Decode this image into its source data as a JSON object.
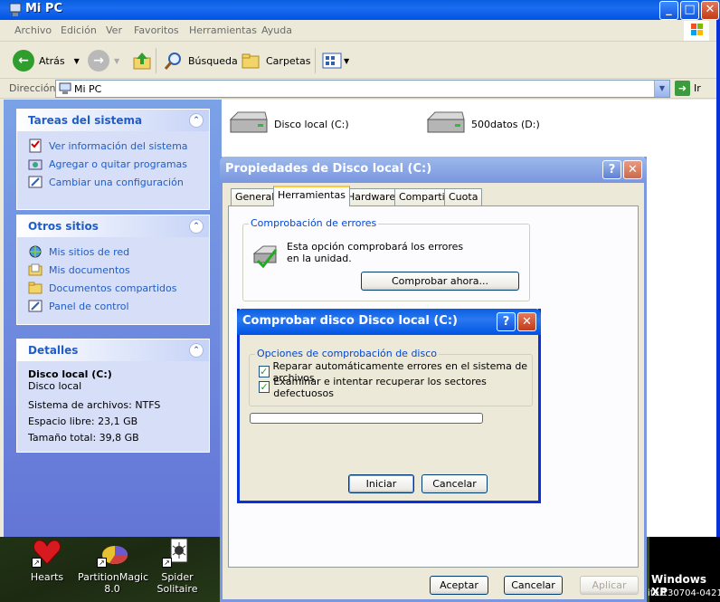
{
  "explorer": {
    "title": "Mi PC",
    "menu": [
      "Archivo",
      "Edición",
      "Ver",
      "Favoritos",
      "Herramientas",
      "Ayuda"
    ],
    "toolbar": {
      "back": "Atrás",
      "search": "Búsqueda",
      "folders": "Carpetas"
    },
    "address": {
      "label": "Dirección",
      "value": "Mi PC",
      "go": "Ir"
    },
    "system_tasks": {
      "title": "Tareas del sistema",
      "items": [
        {
          "label": "Ver información del sistema",
          "icon": "system-info-icon"
        },
        {
          "label": "Agregar o quitar programas",
          "icon": "add-remove-icon"
        },
        {
          "label": "Cambiar una configuración",
          "icon": "control-panel-icon"
        }
      ]
    },
    "other_places": {
      "title": "Otros sitios",
      "items": [
        {
          "label": "Mis sitios de red",
          "icon": "network-icon"
        },
        {
          "label": "Mis documentos",
          "icon": "documents-icon"
        },
        {
          "label": "Documentos compartidos",
          "icon": "shared-folder-icon"
        },
        {
          "label": "Panel de control",
          "icon": "control-panel-icon"
        }
      ]
    },
    "details": {
      "title": "Detalles",
      "name": "Disco local (C:)",
      "type": "Disco local",
      "filesystem": "Sistema de archivos: NTFS",
      "free": "Espacio libre: 23,1 GB",
      "total": "Tamaño total: 39,8 GB"
    },
    "drives": [
      {
        "label": "Disco local (C:)"
      },
      {
        "label": "500datos (D:)"
      }
    ]
  },
  "properties_dialog": {
    "title": "Propiedades de Disco local (C:)",
    "tabs": [
      "General",
      "Herramientas",
      "Hardware",
      "Compartir",
      "Cuota"
    ],
    "active_tab": "Herramientas",
    "error_check": {
      "group_label": "Comprobación de errores",
      "description": "Esta opción comprobará los errores en la unidad.",
      "button": "Comprobar ahora..."
    },
    "buttons": {
      "ok": "Aceptar",
      "cancel": "Cancelar",
      "apply": "Aplicar"
    }
  },
  "check_dialog": {
    "title": "Comprobar disco Disco local (C:)",
    "group_label": "Opciones de comprobación de disco",
    "options": [
      {
        "label": "Reparar automáticamente errores en el sistema de archivos",
        "checked": true
      },
      {
        "label": "Examinar e intentar recuperar los sectores defectuosos",
        "checked": true
      }
    ],
    "progress": 0,
    "buttons": {
      "start": "Iniciar",
      "cancel": "Cancelar"
    }
  },
  "desktop": {
    "icons": [
      {
        "label": "Hearts"
      },
      {
        "label": "PartitionMagic 8.0"
      },
      {
        "label": "Spider Solitaire"
      }
    ],
    "os_label": "Windows XP",
    "build": "ife.130704-0421"
  }
}
